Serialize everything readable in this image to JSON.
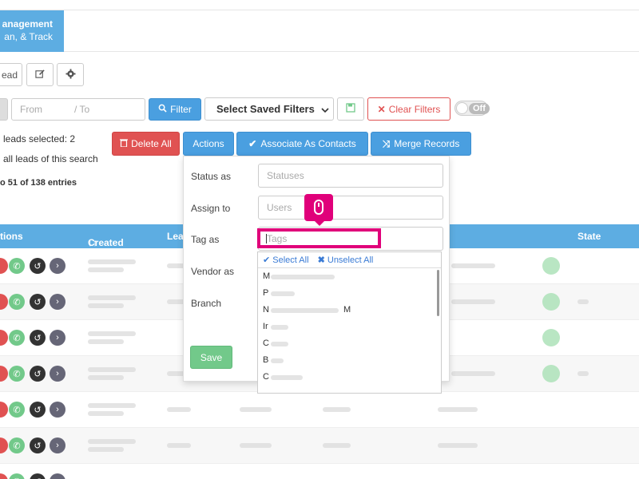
{
  "header": {
    "module_line1": "anagement",
    "module_line2": "an, & Track"
  },
  "toolbar": {
    "read_label": "ead",
    "edit_icon": "edit-icon",
    "settings_icon": "gear-icon"
  },
  "filters": {
    "from_placeholder": "From",
    "to_placeholder": "/ To",
    "filter_label": "Filter",
    "saved_filters_label": "Select Saved Filters",
    "clear_filters_label": "Clear Filters",
    "toggle_label": "Off"
  },
  "selection": {
    "leads_selected": "leads selected: 2",
    "all_leads": "all leads of this search",
    "entries": "o 51 of 138 entries"
  },
  "actions": {
    "delete_all": "Delete All",
    "actions": "Actions",
    "associate_contacts": "Associate As Contacts",
    "merge_records": "Merge Records"
  },
  "table": {
    "columns": [
      "tions",
      "Created",
      "Lea",
      "State"
    ],
    "row_count": 7
  },
  "dropdown": {
    "status_label": "Status as",
    "status_placeholder": "Statuses",
    "assign_label": "Assign to",
    "assign_placeholder": "Users",
    "tag_label": "Tag as",
    "tag_placeholder": "Tags",
    "vendor_label": "Vendor as",
    "branch_label": "Branch",
    "save_label": "Save"
  },
  "tag_list": {
    "select_all": "Select All",
    "unselect_all": "Unselect All",
    "items": [
      "M",
      "P",
      "N",
      "Ir",
      "C",
      "B",
      "C"
    ],
    "trailing_m": "M"
  },
  "colors": {
    "accent_blue": "#5dade2",
    "highlight_pink": "#e0007a",
    "danger_red": "#e05252",
    "success_green": "#72c98a"
  }
}
